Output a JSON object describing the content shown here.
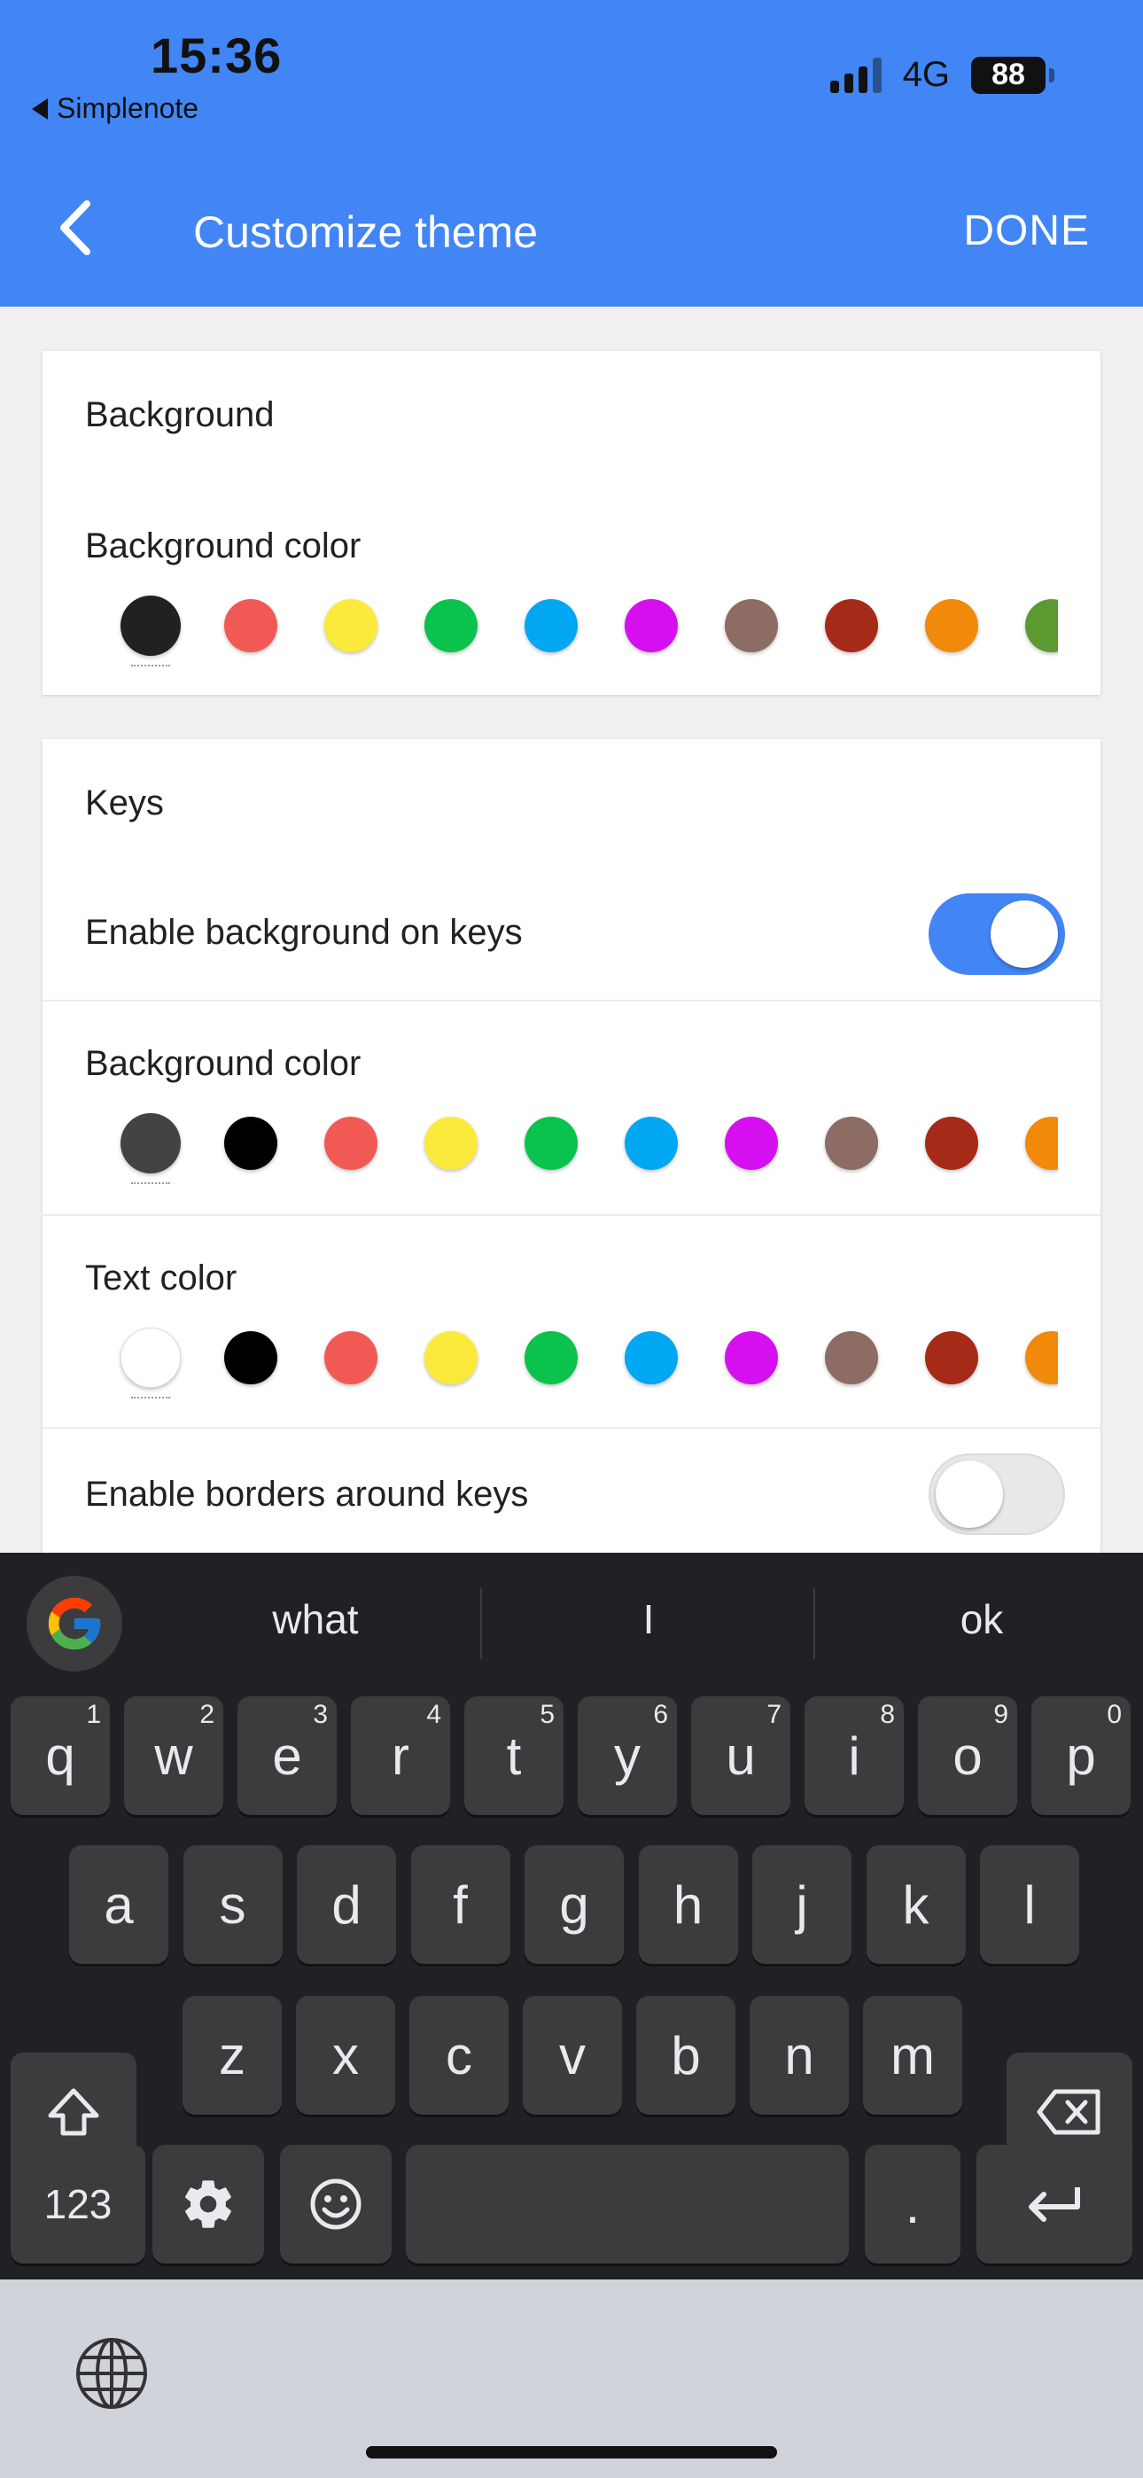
{
  "status": {
    "time": "15:36",
    "back_app": "Simplenote",
    "network": "4G",
    "battery": "88"
  },
  "appbar": {
    "title": "Customize theme",
    "done": "DONE"
  },
  "background_section": {
    "title": "Background",
    "bg_color_label": "Background color",
    "colors": [
      "#212121",
      "#f15a54",
      "#fbea3b",
      "#0ac34c",
      "#02a7f3",
      "#d60ff0",
      "#8c6c63",
      "#a62a18",
      "#f18a0a",
      "#5a9a30"
    ]
  },
  "keys_section": {
    "title": "Keys",
    "enable_bg_label": "Enable background on keys",
    "enable_bg_on": true,
    "bg_color_label": "Background color",
    "bg_colors": [
      "#434343",
      "#000000",
      "#f15a54",
      "#fbea3b",
      "#0ac34c",
      "#02a7f3",
      "#d60ff0",
      "#8c6c63",
      "#a62a18",
      "#f18a0a"
    ],
    "text_color_label": "Text color",
    "text_colors": [
      "#ffffff",
      "#000000",
      "#f15a54",
      "#fbea3b",
      "#0ac34c",
      "#02a7f3",
      "#d60ff0",
      "#8c6c63",
      "#a62a18",
      "#f18a0a"
    ],
    "enable_borders_label": "Enable borders around keys",
    "enable_borders_on": false
  },
  "keyboard": {
    "suggestions": [
      "what",
      "I",
      "ok"
    ],
    "row1": [
      [
        "q",
        "1"
      ],
      [
        "w",
        "2"
      ],
      [
        "e",
        "3"
      ],
      [
        "r",
        "4"
      ],
      [
        "t",
        "5"
      ],
      [
        "y",
        "6"
      ],
      [
        "u",
        "7"
      ],
      [
        "i",
        "8"
      ],
      [
        "o",
        "9"
      ],
      [
        "p",
        "0"
      ]
    ],
    "row2": [
      "a",
      "s",
      "d",
      "f",
      "g",
      "h",
      "j",
      "k",
      "l"
    ],
    "row3": [
      "z",
      "x",
      "c",
      "v",
      "b",
      "n",
      "m"
    ],
    "numbers_key": "123",
    "period_key": "."
  }
}
